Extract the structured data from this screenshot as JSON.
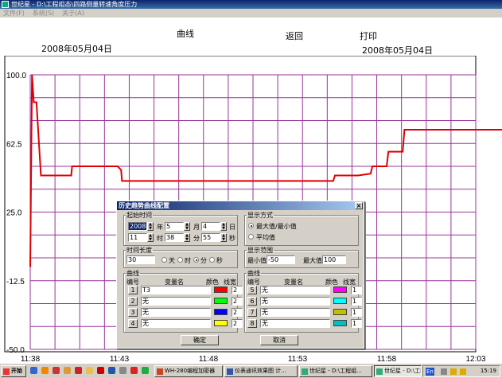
{
  "window": {
    "title": "世纪星 - D:\\工程组态\\四路侧量转速角度压力"
  },
  "menu": [
    "文件(F)",
    "系统(S)",
    "关于(A)"
  ],
  "header": {
    "curve": "曲线",
    "back": "返回",
    "print": "打印",
    "date_left": "2008年05月04日",
    "date_right": "2008年05月04日"
  },
  "chart_data": {
    "type": "line",
    "ylim": [
      -50,
      100
    ],
    "y_ticks": [
      "100.0",
      "62.5",
      "25.0",
      "-12.5",
      "-50.0"
    ],
    "x_ticks": [
      "11:38",
      "11:43",
      "11:48",
      "11:53",
      "11:58",
      "12:03"
    ],
    "grid": true,
    "series": [
      {
        "color": "#dd0000",
        "points": [
          [
            0,
            -5
          ],
          [
            0.1,
            100
          ],
          [
            0.2,
            85
          ],
          [
            0.35,
            85
          ],
          [
            0.6,
            45
          ],
          [
            1.0,
            45
          ],
          [
            2.3,
            45
          ],
          [
            2.35,
            50
          ],
          [
            4.9,
            50
          ],
          [
            5.1,
            48
          ],
          [
            5.15,
            42
          ],
          [
            10.0,
            42
          ],
          [
            17.0,
            42
          ],
          [
            17.1,
            45
          ],
          [
            18.4,
            45
          ],
          [
            19.1,
            46
          ],
          [
            19.2,
            50
          ],
          [
            20.0,
            50
          ],
          [
            20.1,
            58
          ],
          [
            20.9,
            58
          ],
          [
            21.0,
            70
          ],
          [
            32.0,
            70
          ],
          [
            32.05,
            -5
          ]
        ]
      }
    ]
  },
  "dialog": {
    "title": "历史趋势曲线配置",
    "close": "×",
    "start_group": "起始时间",
    "year": "2008",
    "year_u": "年",
    "month": "5",
    "month_u": "月",
    "day": "4",
    "day_u": "日",
    "hour": "11",
    "hour_u": "时",
    "minute": "38",
    "minute_u": "分",
    "second": "55",
    "second_u": "秒",
    "mode_group": "显示方式",
    "mode_opts": [
      "最大值/最小值",
      "平均值"
    ],
    "len_group": "时间长度",
    "len_value": "30",
    "units": [
      "天",
      "时",
      "分",
      "秒"
    ],
    "range_group": "显示范围",
    "min_label": "最小值",
    "min_value": "-50",
    "max_label": "最大值",
    "max_value": "100",
    "curve_group": "曲线",
    "col_no": "编号",
    "col_var": "变量名",
    "col_color": "颜色",
    "col_width": "线宽",
    "left": [
      {
        "n": "1",
        "name": "T3",
        "color": "#ff0000",
        "w": "2"
      },
      {
        "n": "2",
        "name": "无",
        "color": "#00ff00",
        "w": "2"
      },
      {
        "n": "3",
        "name": "无",
        "color": "#0000ff",
        "w": "2"
      },
      {
        "n": "4",
        "name": "无",
        "color": "#ffff00",
        "w": "2"
      }
    ],
    "right": [
      {
        "n": "5",
        "name": "无",
        "color": "#ff00ff",
        "w": "1"
      },
      {
        "n": "6",
        "name": "无",
        "color": "#00ffff",
        "w": "1"
      },
      {
        "n": "7",
        "name": "无",
        "color": "#c0c000",
        "w": "1"
      },
      {
        "n": "8",
        "name": "无",
        "color": "#00c0c0",
        "w": "1"
      }
    ],
    "ok": "确定",
    "cancel": "取消"
  },
  "taskbar": {
    "start": "开始",
    "items": [
      "WH-280编程加密器",
      "仪表通讯效果图 计...",
      "世纪星 - D:\\工程组...",
      "世纪星 - D:\\工程组态..."
    ],
    "lang": "En",
    "clock": "15:19"
  }
}
